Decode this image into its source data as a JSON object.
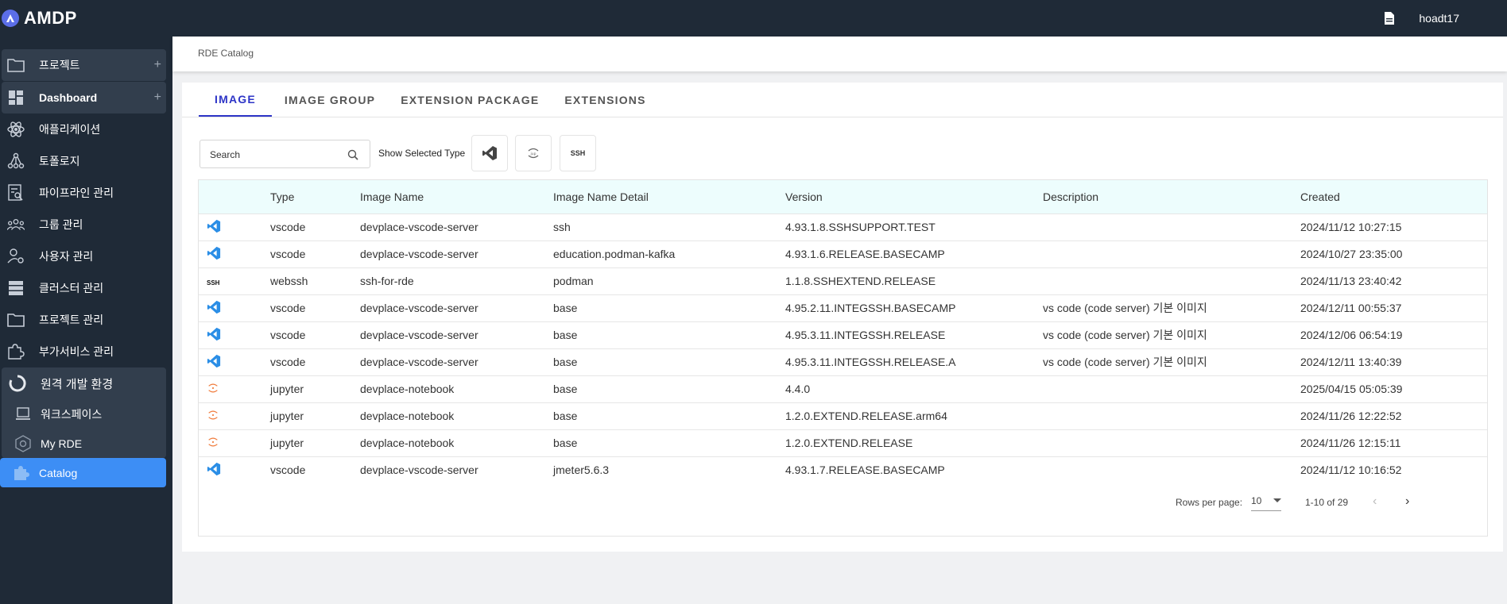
{
  "app": {
    "title": "AMDP",
    "user": "hoadt17"
  },
  "sidebar": {
    "items": [
      {
        "label": "프로젝트",
        "icon": "folder-icon",
        "style": "section",
        "plus": "+"
      },
      {
        "label": "Dashboard",
        "icon": "dashboard-icon",
        "style": "section",
        "plus": "+"
      },
      {
        "label": "애플리케이션",
        "icon": "atom-icon"
      },
      {
        "label": "토폴로지",
        "icon": "topology-icon"
      },
      {
        "label": "파이프라인 관리",
        "icon": "pipeline-icon"
      },
      {
        "label": "그룹 관리",
        "icon": "group-icon"
      },
      {
        "label": "사용자 관리",
        "icon": "user-settings-icon"
      },
      {
        "label": "클러스터 관리",
        "icon": "server-icon"
      },
      {
        "label": "프로젝트 관리",
        "icon": "folder-icon"
      },
      {
        "label": "부가서비스 관리",
        "icon": "puzzle-settings-icon"
      }
    ],
    "rde_group": {
      "label": "원격 개발 환경",
      "children": [
        {
          "label": "워크스페이스",
          "icon": "laptop-icon"
        },
        {
          "label": "My RDE",
          "icon": "gear-cube-icon"
        },
        {
          "label": "Catalog",
          "icon": "puzzle-icon",
          "active": true
        }
      ]
    }
  },
  "breadcrumb": "RDE Catalog",
  "tabs": [
    "IMAGE",
    "IMAGE GROUP",
    "EXTENSION PACKAGE",
    "EXTENSIONS"
  ],
  "active_tab": "IMAGE",
  "filters": {
    "search_placeholder": "Search",
    "show_selected_type_label": "Show Selected Type",
    "ssh_badge": "SSH"
  },
  "table": {
    "headers": [
      "",
      "Type",
      "Image Name",
      "Image Name Detail",
      "Version",
      "Description",
      "Created"
    ],
    "rows": [
      {
        "icon": "vscode",
        "type": "vscode",
        "name": "devplace-vscode-server",
        "detail": "ssh",
        "version": "4.93.1.8.SSHSUPPORT.TEST",
        "description": "",
        "created": "2024/11/12 10:27:15"
      },
      {
        "icon": "vscode",
        "type": "vscode",
        "name": "devplace-vscode-server",
        "detail": "education.podman-kafka",
        "version": "4.93.1.6.RELEASE.BASECAMP",
        "description": "",
        "created": "2024/10/27 23:35:00"
      },
      {
        "icon": "ssh",
        "type": "webssh",
        "name": "ssh-for-rde",
        "detail": "podman",
        "version": "1.1.8.SSHEXTEND.RELEASE",
        "description": "",
        "created": "2024/11/13 23:40:42"
      },
      {
        "icon": "vscode",
        "type": "vscode",
        "name": "devplace-vscode-server",
        "detail": "base",
        "version": "4.95.2.11.INTEGSSH.BASECAMP",
        "description": "vs code (code server) 기본 이미지",
        "created": "2024/12/11 00:55:37"
      },
      {
        "icon": "vscode",
        "type": "vscode",
        "name": "devplace-vscode-server",
        "detail": "base",
        "version": "4.95.3.11.INTEGSSH.RELEASE",
        "description": "vs code (code server) 기본 이미지",
        "created": "2024/12/06 06:54:19"
      },
      {
        "icon": "vscode",
        "type": "vscode",
        "name": "devplace-vscode-server",
        "detail": "base",
        "version": "4.95.3.11.INTEGSSH.RELEASE.A",
        "description": "vs code (code server) 기본 이미지",
        "created": "2024/12/11 13:40:39"
      },
      {
        "icon": "jupyter",
        "type": "jupyter",
        "name": "devplace-notebook",
        "detail": "base",
        "version": "4.4.0",
        "description": "",
        "created": "2025/04/15 05:05:39"
      },
      {
        "icon": "jupyter",
        "type": "jupyter",
        "name": "devplace-notebook",
        "detail": "base",
        "version": "1.2.0.EXTEND.RELEASE.arm64",
        "description": "",
        "created": "2024/11/26 12:22:52"
      },
      {
        "icon": "jupyter",
        "type": "jupyter",
        "name": "devplace-notebook",
        "detail": "base",
        "version": "1.2.0.EXTEND.RELEASE",
        "description": "",
        "created": "2024/11/26 12:15:11"
      },
      {
        "icon": "vscode",
        "type": "vscode",
        "name": "devplace-vscode-server",
        "detail": "jmeter5.6.3",
        "version": "4.93.1.7.RELEASE.BASECAMP",
        "description": "",
        "created": "2024/11/12 10:16:52"
      }
    ]
  },
  "pagination": {
    "rows_per_page_label": "Rows per page:",
    "rows_per_page": "10",
    "range": "1-10 of 29",
    "prev": "‹",
    "next": "›"
  },
  "colors": {
    "topbar": "#1f2a37",
    "active_nav": "#3d8ef5",
    "active_tab": "#2e35c7",
    "header_row": "#edfdfd",
    "vscode": "#2b8ee6",
    "jupyter": "#f07a3a"
  }
}
